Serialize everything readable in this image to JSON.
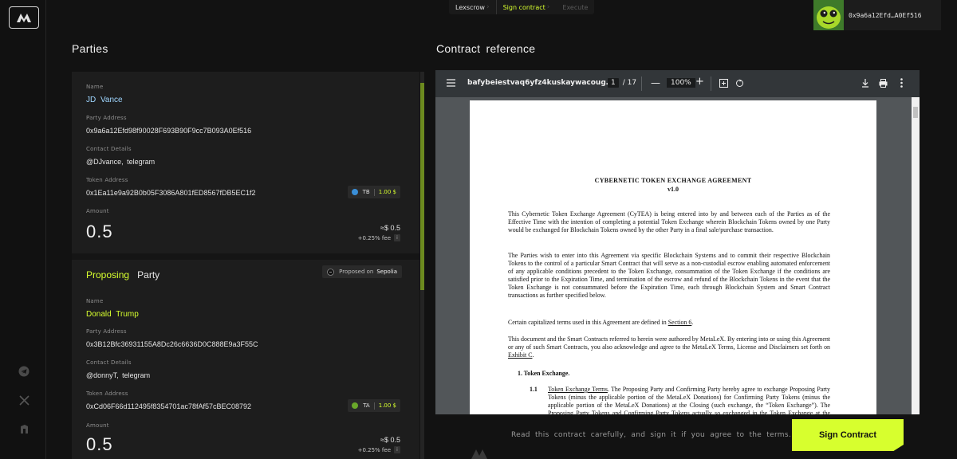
{
  "steps": [
    {
      "label": "Lexscrow",
      "state": "done"
    },
    {
      "label": "Sign contract",
      "state": "active"
    },
    {
      "label": "Execute",
      "state": "pending"
    }
  ],
  "wallet": {
    "address": "0x9a6a12Efd…A0Ef516"
  },
  "sections": {
    "parties": "Parties",
    "contract": "Contract reference"
  },
  "confirming": {
    "name_label": "Name",
    "name": "JD Vance",
    "address_label": "Party Address",
    "address": "0x9a6a12Efd98f90028F693B90F9cc7B093A0Ef516",
    "contact_label": "Contact Details",
    "contact": "@DJvance, telegram",
    "token_label": "Token Address",
    "token_address": "0x1Ea11e9a92B0b05F3086A801fED8567fDB5EC1f2",
    "token_symbol": "TB",
    "token_price": "1.00 $",
    "amount_label": "Amount",
    "amount": "0.5",
    "approx": "≈$ 0.5",
    "fee": "+0.25% fee"
  },
  "proposing": {
    "title_a": "Proposing",
    "title_b": "Party",
    "badge_prefix": "Proposed on",
    "badge_network": "Sepolia",
    "name_label": "Name",
    "name": "Donald Trump",
    "address_label": "Party Address",
    "address": "0x3B12Bfc36931155A8Dc26c6636D0C888E9a3F55C",
    "contact_label": "Contact Details",
    "contact": "@donnyT, telegram",
    "token_label": "Token Address",
    "token_address": "0xCd06F66d112495f8354701ac78fAf57cBEC08792",
    "token_symbol": "TA",
    "token_price": "1.00 $",
    "amount_label": "Amount",
    "amount": "0.5",
    "approx": "≈$ 0.5",
    "fee": "+0.25% fee"
  },
  "viewer": {
    "filename": "bafybeiestvaq6yfz4kuskaywacoug…",
    "page": "1",
    "page_total": "/ 17",
    "zoom": "100%"
  },
  "doc": {
    "title": "CYBERNETIC TOKEN EXCHANGE AGREEMENT",
    "version": "v1.0",
    "p1": "This Cybernetic Token Exchange Agreement (CyTEA) is being entered into by and between each of the Parties as of the Effective Time with the intention of completing a potential Token Exchange wherein Blockchain Tokens owned by one Party would be exchanged for Blockchain Tokens owned by the other Party in a final sale/purchase transaction.",
    "p2": "The Parties wish to enter into this Agreement via specific Blockchain Systems and to commit their respective Blockchain Tokens to the control of a particular Smart Contract that will serve as a non-custodial escrow enabling automated enforcement of any applicable conditions precedent to the Token Exchange, consummation of the Token Exchange if the conditions are satisfied prior to the Expiration Time, and termination of the escrow and refund of the Blockchain Tokens in the event that the Token Exchange is not consummated before the Expiration Time, each through Blockchain System and Smart Contract transactions as further specified below.",
    "p3_pre": "Certain capitalized terms used in this Agreement are defined in ",
    "p3_link": "Section 6",
    "p3_post": ".",
    "p4_pre": "This document and the Smart Contracts referred to herein were authored by MetaLeX. By entering into or using this Agreement or any of such Smart Contracts, you also acknowledge and agree to the MetaLeX Terms, License and Disclaimers set forth on ",
    "p4_link": "Exhibit C",
    "p4_post": ".",
    "h1": "1.  Token Exchange.",
    "s11_num": "1.1",
    "s11_title": "Token Exchange Terms",
    "s11_text": ". The Proposing Party and Confirming Party hereby agree to exchange Proposing Party Tokens (minus the applicable portion of the MetaLeX Donations) for Confirming Party Tokens (minus the applicable portion of the MetaLeX Donations) at the Closing (such exchange, the “Token Exchange”). The Proposing Party Tokens and Confirming Party Tokens actually so exchanged in the Token Exchange at the Closing are referred to herein as the “Exchanged Tokens”."
  },
  "footer": {
    "message": "Read this contract carefully, and sign it if you agree to the terms.",
    "sign_label": "Sign Contract"
  },
  "colors": {
    "accent": "#d7ff2e",
    "name_blue": "#9fd6ff",
    "viewer_bg": "#525659",
    "toolbar_bg": "#323639"
  }
}
